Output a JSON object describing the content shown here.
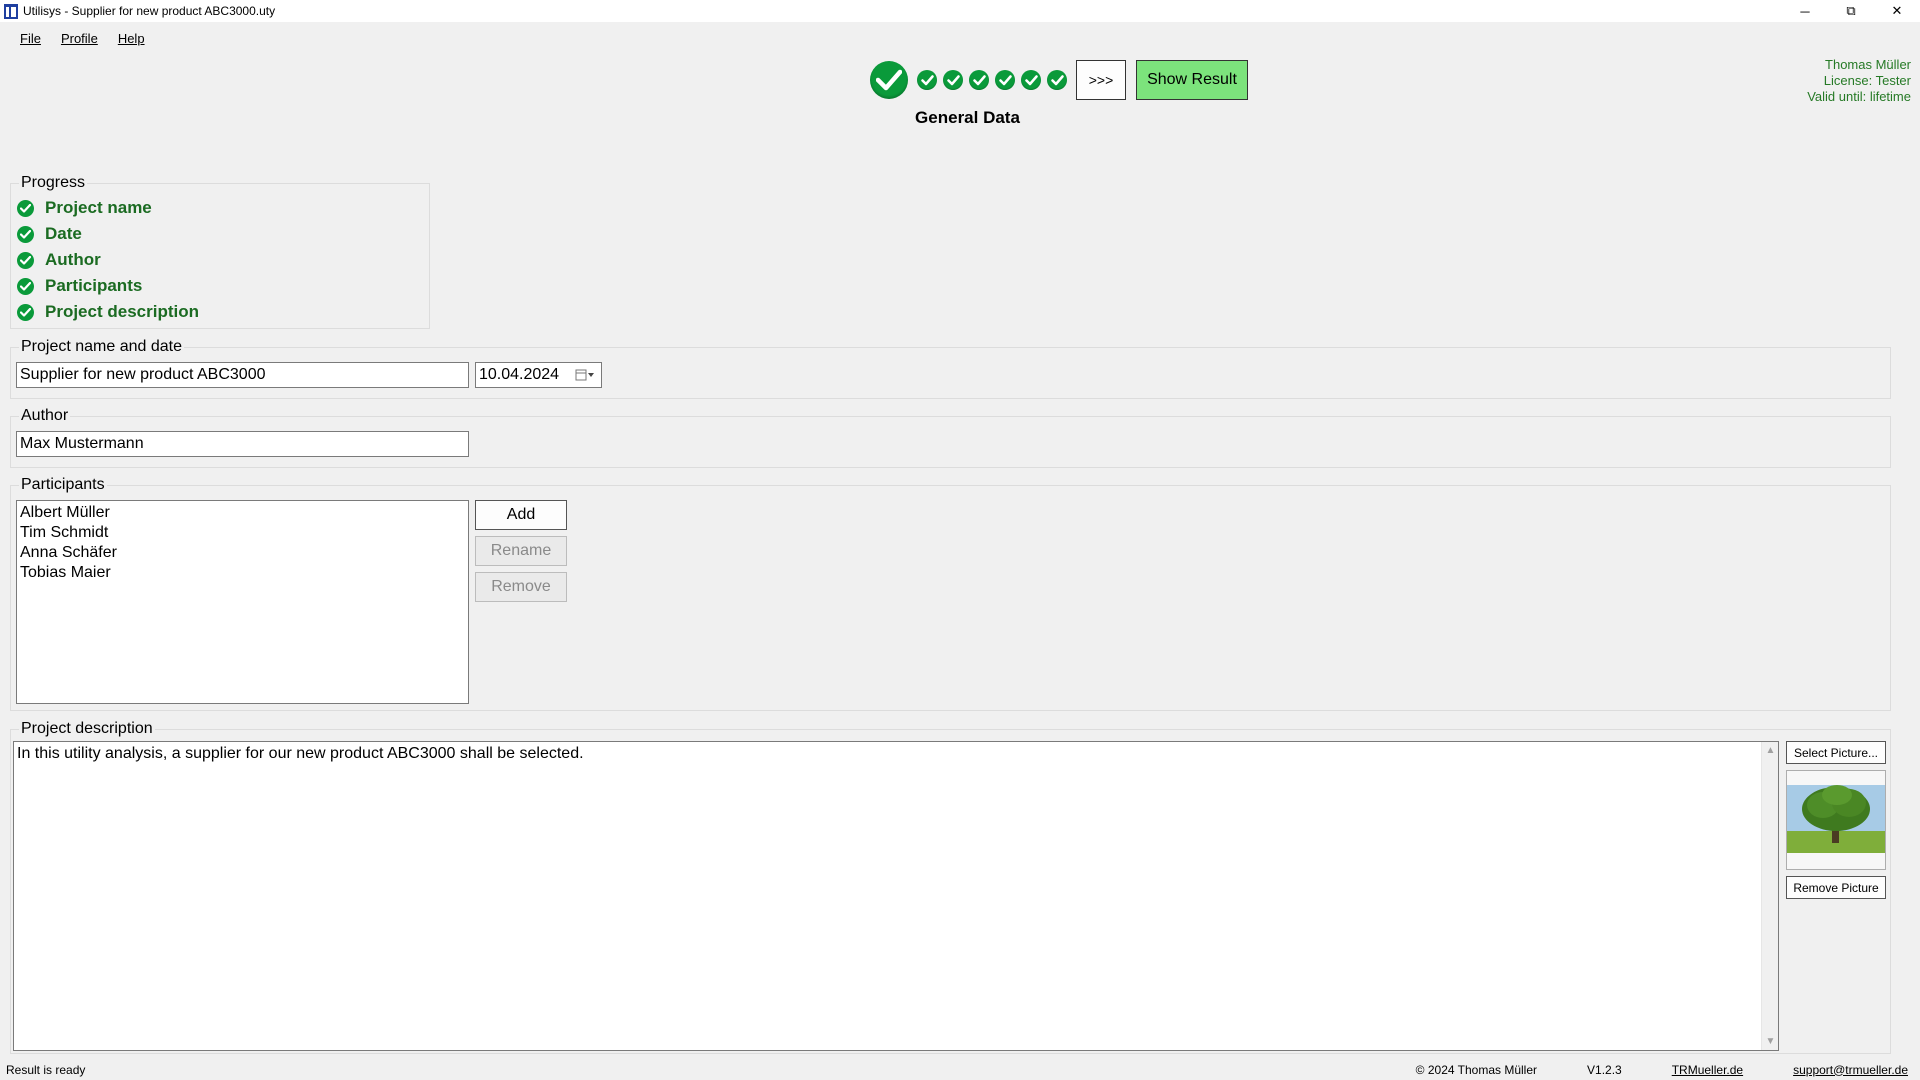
{
  "window": {
    "title": "Utilisys - Supplier for new product ABC3000.uty",
    "minimize": "─",
    "restore": "⧉",
    "close": "✕"
  },
  "menu": {
    "file": "File",
    "profile": "Profile",
    "help": "Help"
  },
  "stepbar": {
    "next_label": ">>>",
    "show_result_label": "Show Result",
    "current_step": "General Data",
    "check_color": "#0a9a3a",
    "result_button_color": "#7ce37c"
  },
  "license": {
    "user": "Thomas Müller",
    "license": "License: Tester",
    "valid": "Valid until: lifetime",
    "color": "#267a26"
  },
  "progress": {
    "label": "Progress",
    "items": [
      "Project name",
      "Date",
      "Author",
      "Participants",
      "Project description"
    ]
  },
  "project": {
    "group_label": "Project name and date",
    "name_value": "Supplier for new product ABC3000",
    "date_value": "10.04.2024"
  },
  "author": {
    "group_label": "Author",
    "value": "Max Mustermann"
  },
  "participants": {
    "group_label": "Participants",
    "items": [
      "Albert Müller",
      "Tim Schmidt",
      "Anna Schäfer",
      "Tobias Maier"
    ],
    "add_label": "Add",
    "rename_label": "Rename",
    "remove_label": "Remove"
  },
  "description": {
    "group_label": "Project description",
    "text": "In this utility analysis, a supplier for our new product ABC3000 shall be selected.",
    "select_picture_label": "Select Picture...",
    "remove_picture_label": "Remove Picture"
  },
  "status": {
    "left": "Result is ready",
    "copyright": "© 2024 Thomas Müller",
    "version": "V1.2.3",
    "website": "TRMueller.de",
    "email": "support@trmueller.de"
  }
}
